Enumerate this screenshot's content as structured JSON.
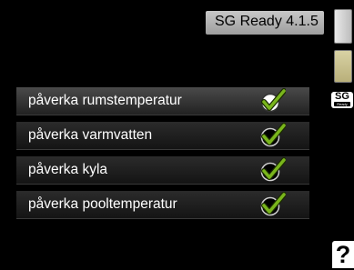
{
  "header": {
    "title": "SG Ready 4.1.5"
  },
  "settings": {
    "items": [
      {
        "label": "påverka rumstemperatur",
        "checked": true,
        "selected": true
      },
      {
        "label": "påverka varmvatten",
        "checked": true,
        "selected": false
      },
      {
        "label": "påverka kyla",
        "checked": true,
        "selected": false
      },
      {
        "label": "påverka pooltemperatur",
        "checked": true,
        "selected": false
      }
    ]
  },
  "side_panel": {
    "sg_badge_main": "SG",
    "sg_badge_sub": "Ready",
    "help_label": "?"
  },
  "colors": {
    "check_green": "#79b51c",
    "check_outline": "#1a2a00"
  }
}
